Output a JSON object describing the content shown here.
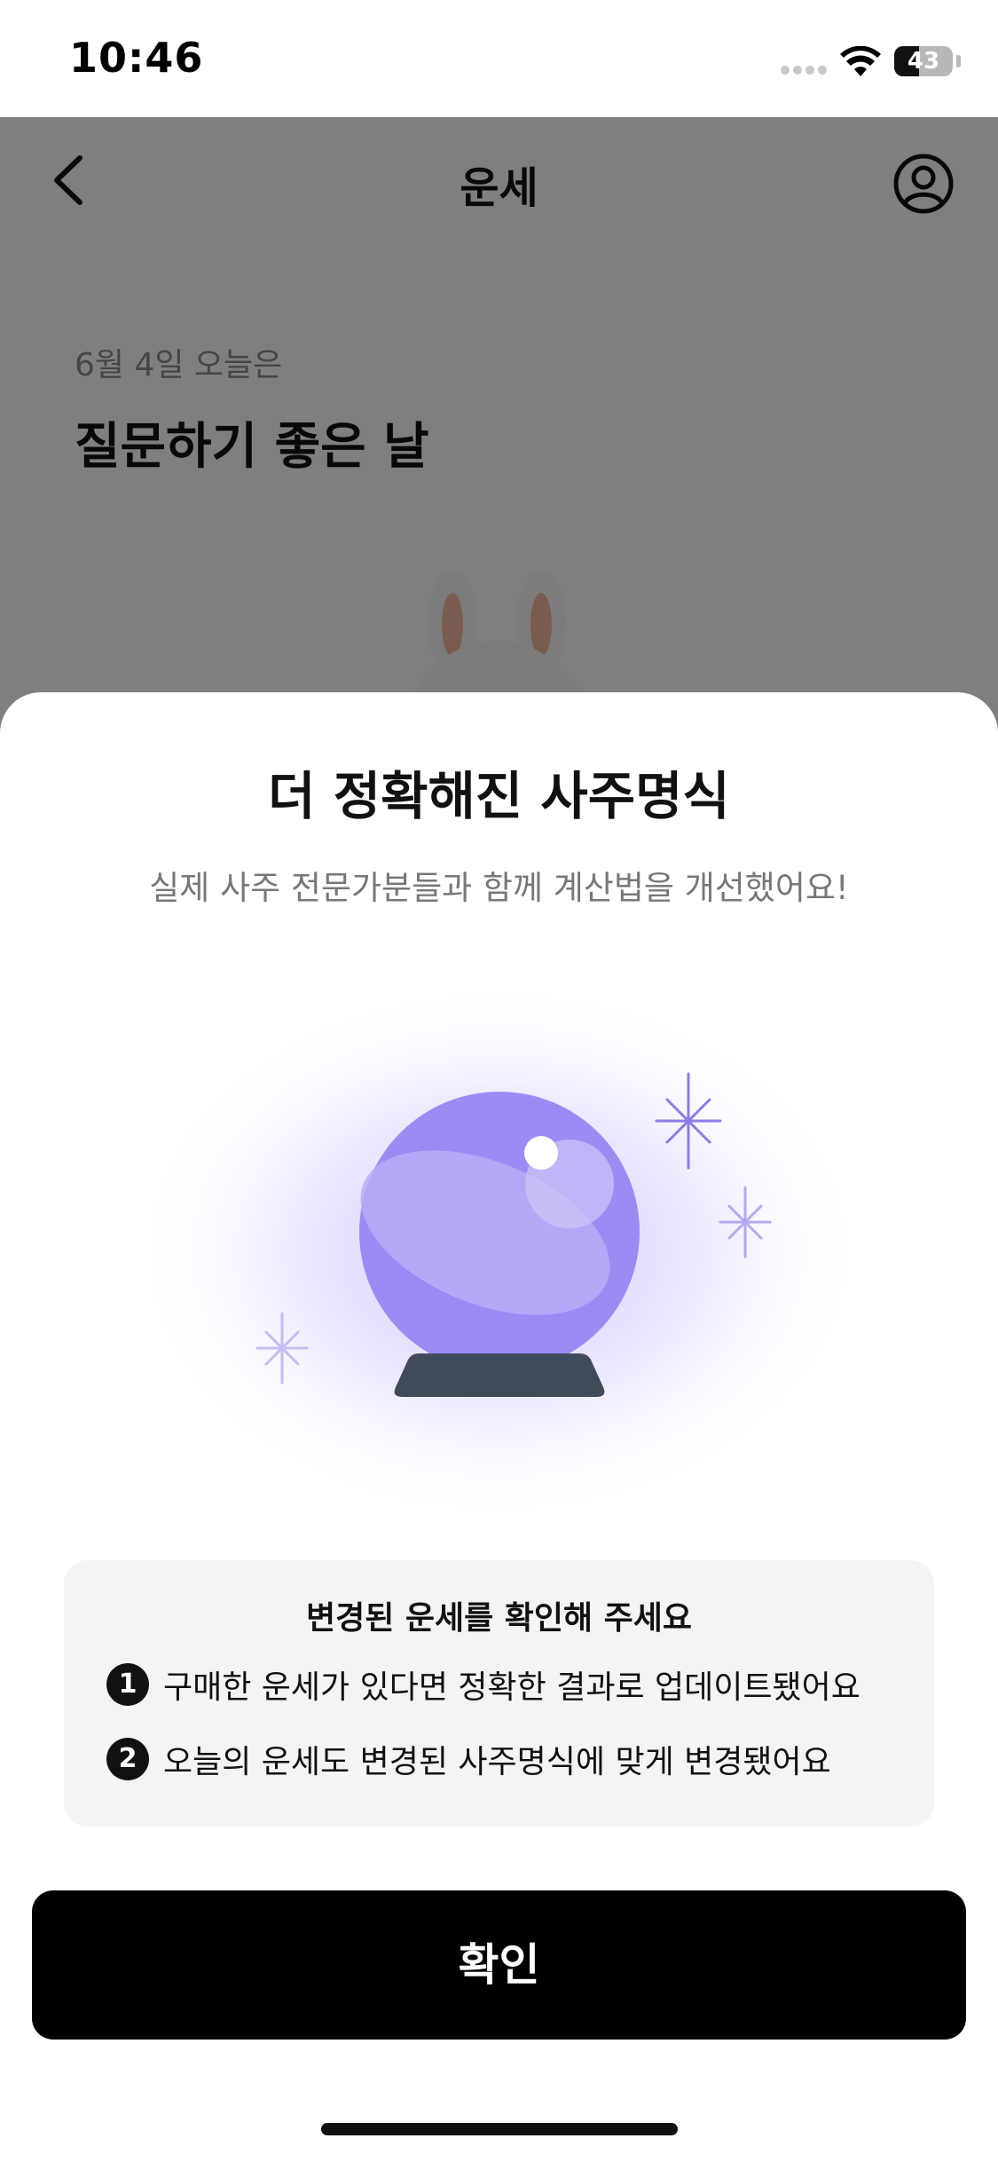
{
  "status_bar": {
    "time": "10:46",
    "battery_level": "43",
    "battery_fraction": 0.43
  },
  "nav": {
    "title": "운세",
    "back_icon": "chevron-left-icon",
    "profile_icon": "user-circle-icon"
  },
  "fortune": {
    "date_label": "6월 4일 오늘은",
    "headline": "질문하기 좋은 날"
  },
  "modal": {
    "title": "더 정확해진 사주명식",
    "subtitle": "실제 사주 전문가분들과 함께 계산법을 개선했어요!",
    "illustration": "crystal-ball-icon",
    "info": {
      "title": "변경된 운세를 확인해 주세요",
      "items": [
        {
          "number": "1",
          "text": "구매한 운세가 있다면 정확한 결과로 업데이트됐어요"
        },
        {
          "number": "2",
          "text": "오늘의 운세도 변경된 사주명식에 맞게 변경됐어요"
        }
      ]
    },
    "confirm_label": "확인"
  },
  "colors": {
    "overlay": "#000000",
    "button_bg": "#000000",
    "crystal_ball": "#9b8cf4",
    "crystal_base": "#3f4b5b",
    "info_bg": "#f4f4f4"
  }
}
